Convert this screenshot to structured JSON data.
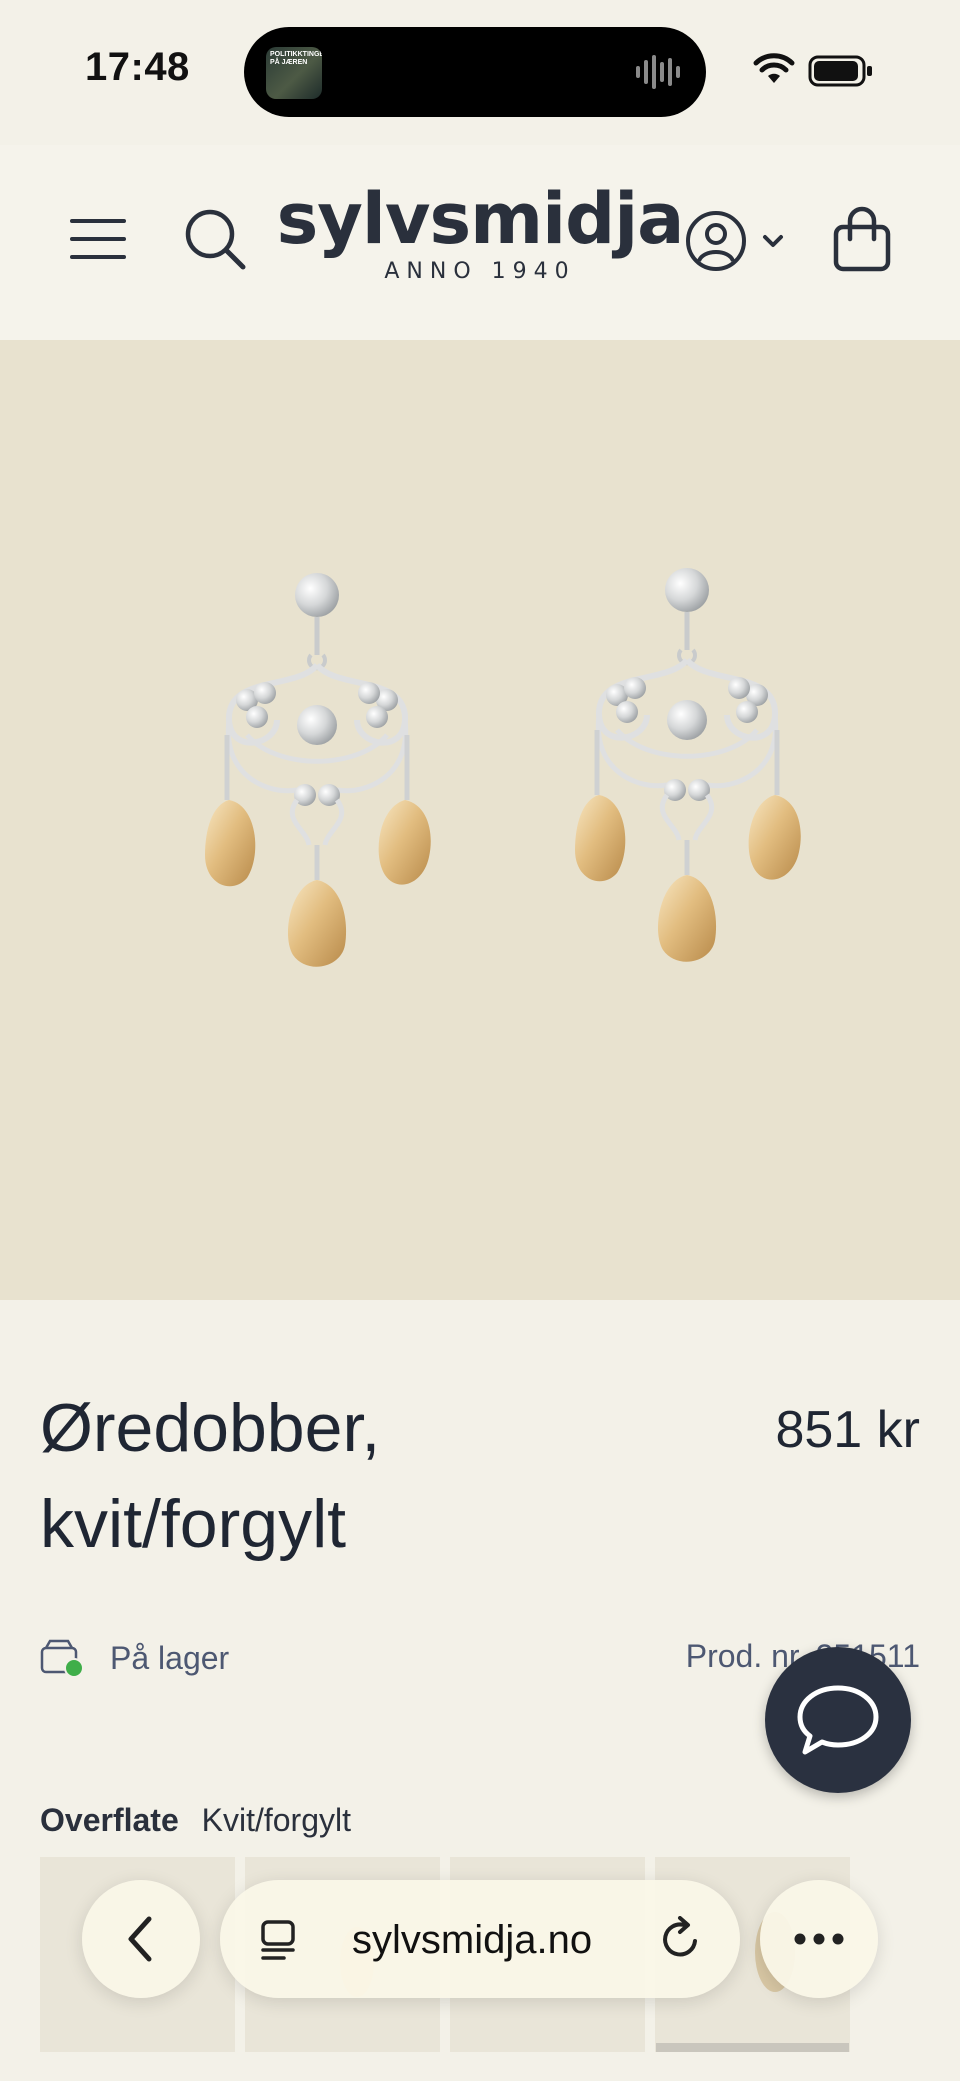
{
  "status_bar": {
    "time": "17:48",
    "island_thumbnail_text": "POLITIKKTINGET PÅ JÆREN"
  },
  "header": {
    "logo": "sylvsmidja",
    "logo_tagline": "ANNO 1940",
    "icons": [
      "menu-icon",
      "search-icon",
      "account-icon",
      "chevron-down-icon",
      "cart-icon"
    ]
  },
  "product": {
    "title_line1": "Øredobber,",
    "title_line2": "kvit/forgylt",
    "price": "851 kr",
    "stock": "På lager",
    "product_number": "Prod. nr. 251511",
    "option_label": "Overflate",
    "option_value": "Kvit/forgylt"
  },
  "browser": {
    "url": "sylvsmidja.no",
    "icons": [
      "back-icon",
      "reader-icon",
      "reload-icon",
      "more-icon"
    ]
  },
  "colors": {
    "background": "#f3f1e8",
    "image_bg": "#e8e2cf",
    "text_dark": "#1f2633",
    "text_muted": "#4d5872",
    "chat_button": "#2a3140",
    "stock_green": "#3fae49"
  }
}
